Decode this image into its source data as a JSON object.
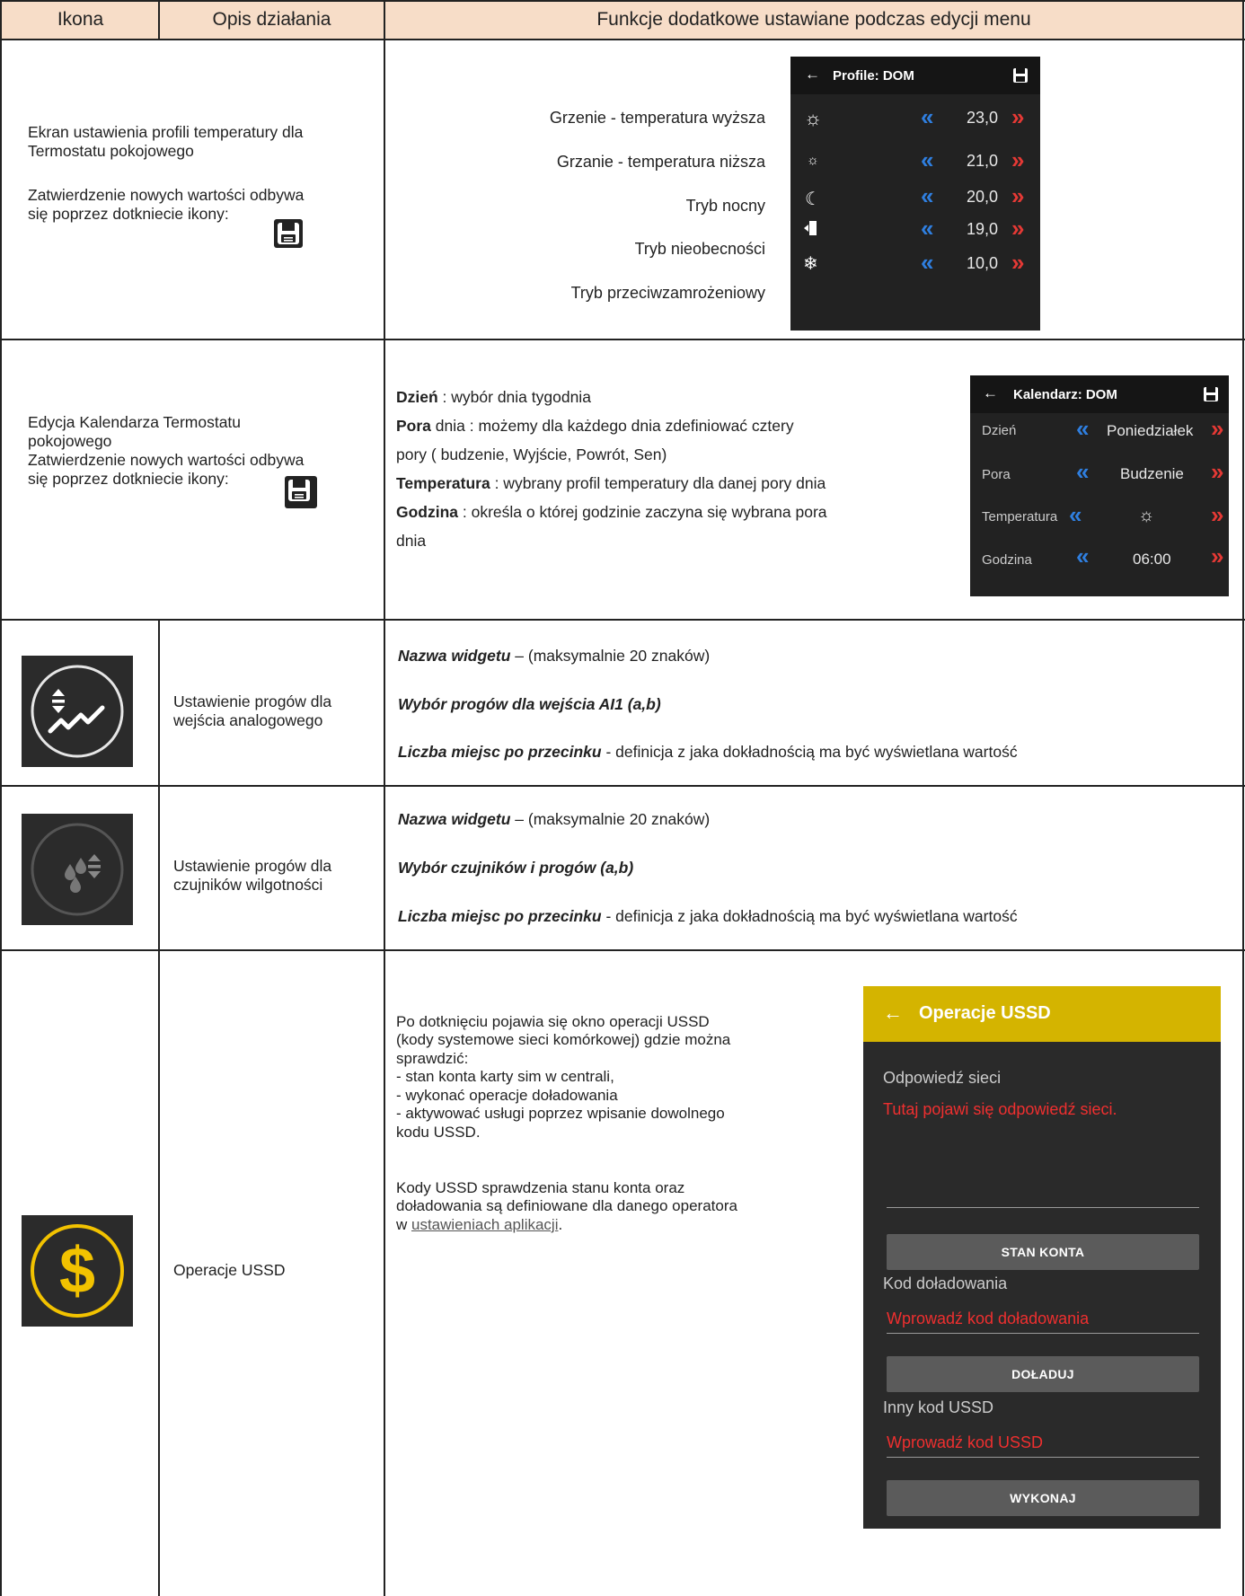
{
  "header": {
    "col1": "Ikona",
    "col2": "Opis działania",
    "col3": "Funkcje dodatkowe ustawiane podczas edycji menu"
  },
  "row1": {
    "desc_line1": "Ekran ustawienia profili temperatury dla",
    "desc_line2": "Termostatu pokojowego",
    "confirm_line1": "Zatwierdzenie nowych wartości odbywa",
    "confirm_line2": "się poprzez dotkniecie ikony:",
    "labels": [
      "Grzenie - temperatura wyższa",
      "Grzanie - temperatura niższa",
      "Tryb nocny",
      "Tryb nieobecności",
      "Tryb przeciwzamrożeniowy"
    ],
    "panel_title": "Profile: DOM",
    "panel_back": "←",
    "values": [
      "23,0",
      "21,0",
      "20,0",
      "19,0",
      "10,0"
    ],
    "icons": [
      "sun-large-icon",
      "sun-small-icon",
      "moon-icon",
      "door-exit-icon",
      "snowflake-icon"
    ]
  },
  "row2": {
    "desc_line1": "Edycja Kalendarza Termostatu",
    "desc_line2": "pokojowego",
    "confirm_line1": "Zatwierdzenie nowych wartości odbywa",
    "confirm_line2": "się poprzez dotkniecie ikony:",
    "p1_bold": "Dzień",
    "p1_rest": " : wybór dnia tygodnia",
    "p2_bold": "Pora",
    "p2_rest": " dnia :  możemy dla każdego dnia zdefiniować cztery",
    "p2_cont": "pory ( budzenie, Wyjście, Powrót, Sen)",
    "p3_bold": "Temperatura",
    "p3_rest": " : wybrany profil temperatury dla danej pory dnia",
    "p4_bold": "Godzina",
    "p4_rest": " : określa o której godzinie zaczyna się wybrana pora",
    "p4_cont": "dnia",
    "panel_title": "Kalendarz: DOM",
    "panel_back": "←",
    "rows": [
      {
        "label": "Dzień",
        "value": "Poniedziałek"
      },
      {
        "label": "Pora",
        "value": "Budzenie"
      },
      {
        "label": "Temperatura",
        "value": "☼"
      },
      {
        "label": "Godzina",
        "value": "06:00"
      }
    ]
  },
  "row3": {
    "icon": "analog-threshold-icon",
    "desc_line1": "Ustawienie progów dla",
    "desc_line2": "wejścia analogowego",
    "f1_bold": "Nazwa widgetu",
    "f1_rest": " – (maksymalnie 20 znaków)",
    "f2_bold": "Wybór progów dla wejścia AI1 (a,b)",
    "f3_bold": "Liczba miejsc po przecinku",
    "f3_rest": "  - definicja z jaka dokładnością ma być wyświetlana wartość"
  },
  "row4": {
    "icon": "humidity-threshold-icon",
    "desc_line1": "Ustawienie progów dla",
    "desc_line2": "czujników wilgotności",
    "f1_bold": "Nazwa widgetu",
    "f1_rest": " – (maksymalnie 20 znaków)",
    "f2_bold": "Wybór czujników i progów (a,b)",
    "f3_bold": "Liczba miejsc po przecinku",
    "f3_rest": "  - definicja z jaka dokładnością ma być wyświetlana wartość"
  },
  "row5": {
    "icon": "dollar-icon",
    "desc": "Operacje USSD",
    "t1": "Po dotknięciu pojawia się okno operacji USSD",
    "t2": "(kody systemowe sieci komórkowej) gdzie można",
    "t3": "sprawdzić:",
    "t4": "- stan konta karty sim w centrali,",
    "t5": "- wykonać operacje doładowania",
    "t6": "- aktywować usługi poprzez wpisanie dowolnego",
    "t7": "kodu USSD.",
    "t8": "Kody USSD sprawdzenia stanu konta oraz",
    "t9": "doładowania są definiowane dla danego operatora",
    "t10_pre": "w ",
    "t10_link": "ustawieniach aplikacji",
    "t10_post": ".",
    "panel": {
      "back": "←",
      "title": "Operacje USSD",
      "title_bg": "#d4b400",
      "response_label": "Odpowiedź sieci",
      "response_text": "Tutaj pojawi się odpowiedź sieci.",
      "btn_balance": "STAN KONTA",
      "topup_label": "Kod doładowania",
      "topup_placeholder": "Wprowadź kod doładowania",
      "btn_topup": "DOŁADUJ",
      "other_label": "Inny kod USSD",
      "other_placeholder": "Wprowadź kod USSD",
      "btn_exec": "WYKONAJ"
    }
  },
  "colors": {
    "header_bg": "#f7ddc8",
    "panel_bg": "#222222",
    "chevron_left": "#2f7fe0",
    "chevron_right": "#e53935",
    "dollar_yellow": "#f2c200"
  }
}
